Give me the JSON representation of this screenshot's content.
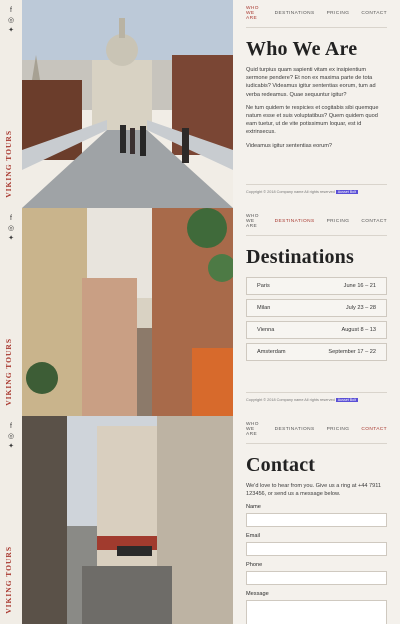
{
  "brand": "VIKING TOURS",
  "nav": {
    "who": "WHO WE ARE",
    "destinations": "DESTINATIONS",
    "pricing": "PRICING",
    "contact": "CONTACT"
  },
  "about": {
    "title": "Who We Are",
    "p1": "Quid turpius quam sapienti vitam ex insipientium sermone pendere? Et non ex maxima parte de tota iudicabis? Videamus igitur sententias eorum, tum ad verba redeamus. Quae sequuntur igitur?",
    "p2": "Ne tum quidem te respicies et cogitabis sibi quemque natum esse et suis voluptatibus? Quem quidem quod eam tuetur, ut de vite potissimum loquar, est id extrinsecus.",
    "p3": "Videamus igitur sententias eorum?"
  },
  "destinations": {
    "title": "Destinations",
    "rows": [
      {
        "city": "Paris",
        "dates": "June 16 – 21"
      },
      {
        "city": "Milan",
        "dates": "July 23 – 28"
      },
      {
        "city": "Vienna",
        "dates": "August 8 – 13"
      },
      {
        "city": "Amsterdam",
        "dates": "September 17 – 22"
      }
    ]
  },
  "contact": {
    "title": "Contact",
    "intro": "We'd love to hear from you. Give us a ring at +44 7911 123456, or send us a message below.",
    "name_label": "Name",
    "email_label": "Email",
    "phone_label": "Phone",
    "message_label": "Message"
  },
  "footer": {
    "copyright": "Copyright © 2018 Company name All rights reserved",
    "badge": "Ausset Bolt"
  },
  "icons": [
    "facebook-icon",
    "instagram-icon",
    "twitter-icon"
  ],
  "colors": {
    "accent": "#a8372e",
    "panel": "#f4f1ec",
    "badge": "#5a4fd6"
  }
}
